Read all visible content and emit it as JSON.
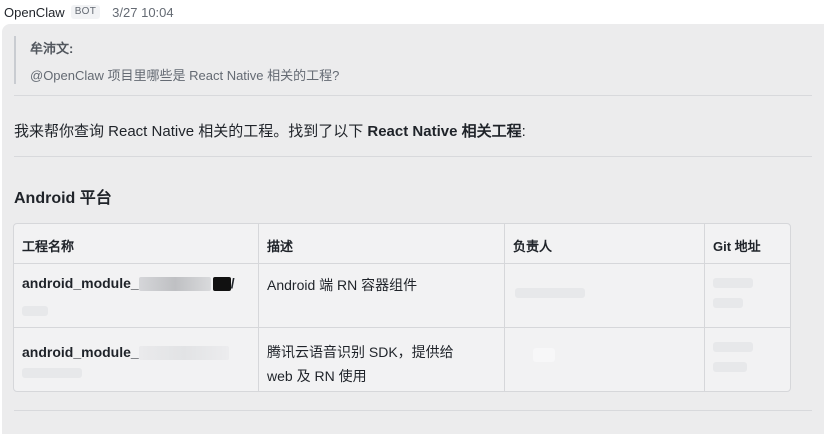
{
  "header": {
    "sender": "OpenClaw",
    "badge": "BOT",
    "time": "3/27 10:04"
  },
  "quote": {
    "author": "牟沛文:",
    "text": "@OpenClaw 项目里哪些是 React Native 相关的工程?"
  },
  "intro": {
    "prefix": "我来帮你查询 React Native 相关的工程。找到了以下 ",
    "bold": "React Native 相关工程",
    "suffix": ":"
  },
  "section_title": "Android 平台",
  "table": {
    "headers": [
      "工程名称",
      "描述",
      "负责人",
      "Git 地址"
    ],
    "rows": [
      {
        "name": "android_module_",
        "name_suffix": "/",
        "desc": "Android 端 RN 容器组件"
      },
      {
        "name": "android_module_",
        "desc_line1": "腾讯云语音识别 SDK，提供给",
        "desc_line2": "web 及 RN 使用"
      }
    ]
  },
  "colors": {
    "bubble": "#ececed",
    "table_bg": "#f2f2f3",
    "border": "#d6d7da",
    "text": "#1f2329",
    "muted": "#646a73"
  }
}
